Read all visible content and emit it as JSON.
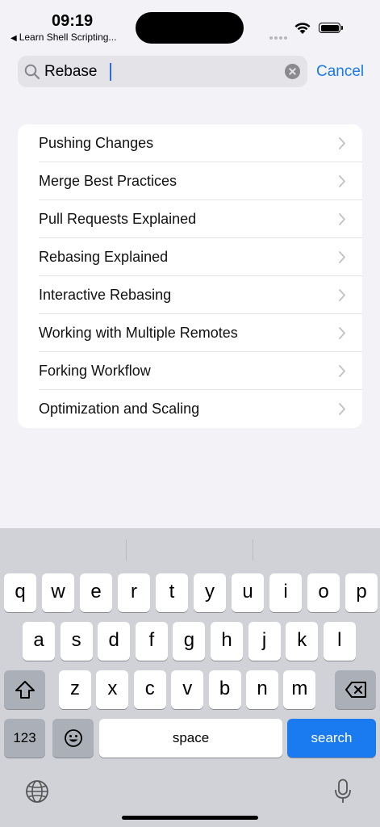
{
  "status": {
    "time": "09:19",
    "back_app": "Learn Shell Scripting..."
  },
  "search": {
    "value": "Rebase",
    "cancel_label": "Cancel"
  },
  "results": [
    {
      "label": "Pushing Changes"
    },
    {
      "label": "Merge Best Practices"
    },
    {
      "label": "Pull Requests Explained"
    },
    {
      "label": "Rebasing Explained"
    },
    {
      "label": "Interactive Rebasing"
    },
    {
      "label": "Working with Multiple Remotes"
    },
    {
      "label": "Forking Workflow"
    },
    {
      "label": "Optimization and Scaling"
    }
  ],
  "keyboard": {
    "row1": [
      "q",
      "w",
      "e",
      "r",
      "t",
      "y",
      "u",
      "i",
      "o",
      "p"
    ],
    "row2": [
      "a",
      "s",
      "d",
      "f",
      "g",
      "h",
      "j",
      "k",
      "l"
    ],
    "row3": [
      "z",
      "x",
      "c",
      "v",
      "b",
      "n",
      "m"
    ],
    "numbers_label": "123",
    "space_label": "space",
    "search_label": "search"
  },
  "colors": {
    "accent": "#1a7af0",
    "background": "#f2f2f7",
    "keyboard_bg": "#d0d2d8"
  }
}
